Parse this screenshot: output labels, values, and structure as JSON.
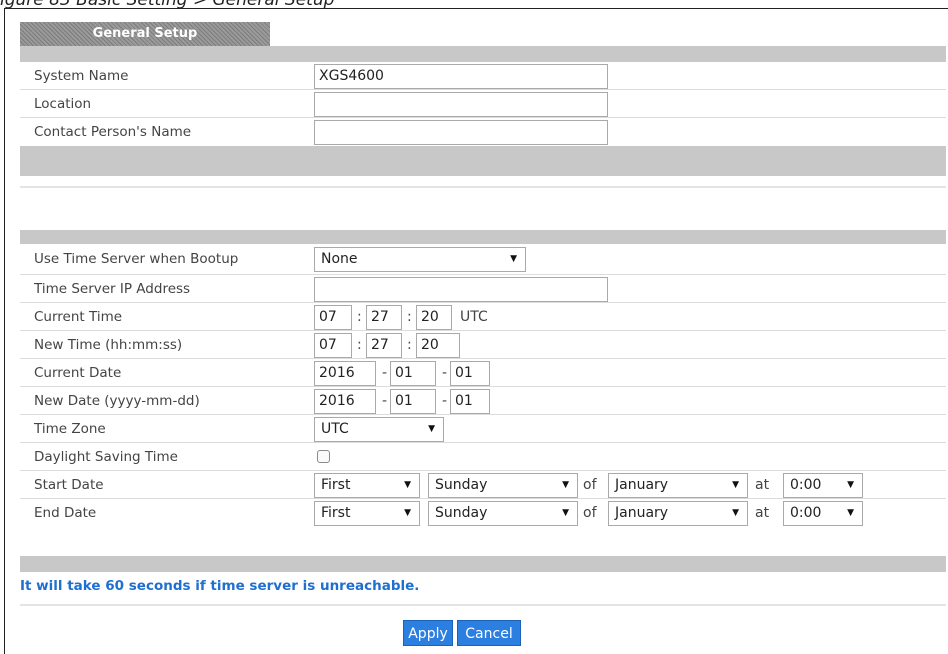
{
  "caption": "igure 83   Basic Setting > General Setup",
  "tab_label": "General Setup",
  "general": {
    "system_name_label": "System Name",
    "system_name_value": "XGS4600",
    "location_label": "Location",
    "location_value": "",
    "contact_label": "Contact Person's Name",
    "contact_value": ""
  },
  "time": {
    "use_time_server_label": "Use Time Server when Bootup",
    "use_time_server_value": "None",
    "time_server_ip_label": "Time Server IP Address",
    "time_server_ip_value": "",
    "current_time_label": "Current Time",
    "current_time": {
      "hh": "07",
      "mm": "27",
      "ss": "20",
      "utc": "UTC"
    },
    "new_time_label": "New Time (hh:mm:ss)",
    "new_time": {
      "hh": "07",
      "mm": "27",
      "ss": "20"
    },
    "current_date_label": "Current Date",
    "current_date": {
      "yyyy": "2016",
      "mm": "01",
      "dd": "01"
    },
    "new_date_label": "New Date (yyyy-mm-dd)",
    "new_date": {
      "yyyy": "2016",
      "mm": "01",
      "dd": "01"
    },
    "time_zone_label": "Time Zone",
    "time_zone_value": "UTC",
    "daylight_label": "Daylight Saving Time",
    "daylight_checked": false,
    "start_date_label": "Start Date",
    "start": {
      "week": "First",
      "day": "Sunday",
      "of": "of",
      "month": "January",
      "at": "at",
      "hour": "0:00"
    },
    "end_date_label": "End Date",
    "end": {
      "week": "First",
      "day": "Sunday",
      "of": "of",
      "month": "January",
      "at": "at",
      "hour": "0:00"
    }
  },
  "note": "It will take 60 seconds if time server is unreachable.",
  "buttons": {
    "apply": "Apply",
    "cancel": "Cancel"
  },
  "colors": {
    "accent": "#2b7fe0",
    "note": "#1f6fd1",
    "bar": "#c8c8c8"
  }
}
